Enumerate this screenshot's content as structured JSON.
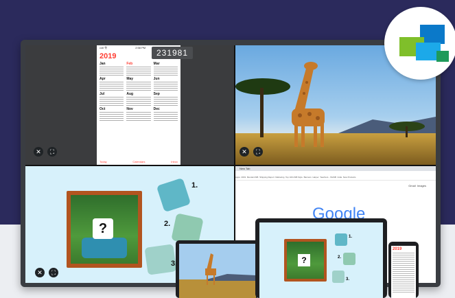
{
  "colors": {
    "background": "#2b2a5c",
    "accent_red": "#ff3b30",
    "google_blue": "#4285F4"
  },
  "code_display": "231981",
  "calendar": {
    "status_left": "•••ll 令",
    "status_time": "2:58 PM",
    "status_right": "7%",
    "year": "2019",
    "months": [
      "Jan",
      "Feb",
      "Mar",
      "Apr",
      "May",
      "Jun",
      "Jul",
      "Aug",
      "Sep",
      "Oct",
      "Nov",
      "Dec"
    ],
    "footer": {
      "left": "Today",
      "center": "Calendars",
      "right": "Inbox"
    }
  },
  "puzzle": {
    "question_mark": "?",
    "pieces": [
      "1.",
      "2.",
      "3."
    ]
  },
  "browser": {
    "tab_title": "New Tab",
    "bookmarks": [
      "Apps",
      "2019",
      "Mendel ASB",
      "Shipping Report",
      "Marketing",
      "Top 100 ASB Style",
      "Banners",
      "Harper",
      "Teachers - ISASB",
      "India",
      "New Products"
    ],
    "google_text": "Google",
    "top_links": [
      "Gmail",
      "Images"
    ]
  },
  "device_tablet": {
    "label": "tablet-savanna"
  },
  "device_laptop": {
    "pieces": [
      "1.",
      "2.",
      "3."
    ],
    "question_mark": "?"
  },
  "device_phone": {
    "year": "2019"
  },
  "icons": [
    "close-icon",
    "expand-icon",
    "app-logo-icon"
  ]
}
